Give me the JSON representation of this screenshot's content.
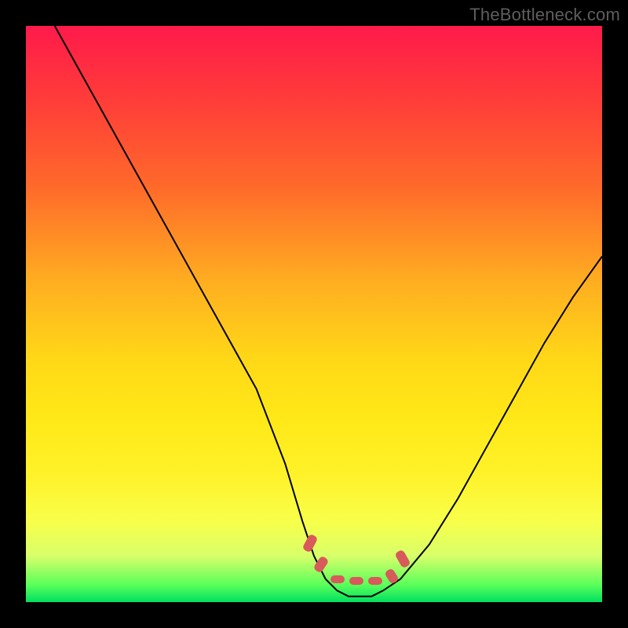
{
  "watermark": "TheBottleneck.com",
  "chart_data": {
    "type": "line",
    "title": "",
    "xlabel": "",
    "ylabel": "",
    "xlim": [
      0,
      100
    ],
    "ylim": [
      0,
      100
    ],
    "series": [
      {
        "name": "curve",
        "x": [
          5,
          10,
          15,
          20,
          25,
          30,
          35,
          40,
          45,
          48,
          50,
          52,
          54,
          56,
          58,
          60,
          62,
          65,
          70,
          75,
          80,
          85,
          90,
          95,
          100
        ],
        "y": [
          100,
          91,
          82,
          73,
          64,
          55,
          46,
          37,
          24,
          14,
          8,
          4,
          2,
          1,
          1,
          1,
          2,
          4,
          10,
          18,
          27,
          36,
          45,
          53,
          60
        ]
      }
    ],
    "optimal_band": {
      "x_start": 50,
      "x_end": 63,
      "y": 2
    },
    "gradient_stops": [
      {
        "pos": 0,
        "color": "#ff1a4b"
      },
      {
        "pos": 45,
        "color": "#ffb020"
      },
      {
        "pos": 78,
        "color": "#fff22a"
      },
      {
        "pos": 100,
        "color": "#00e060"
      }
    ]
  }
}
